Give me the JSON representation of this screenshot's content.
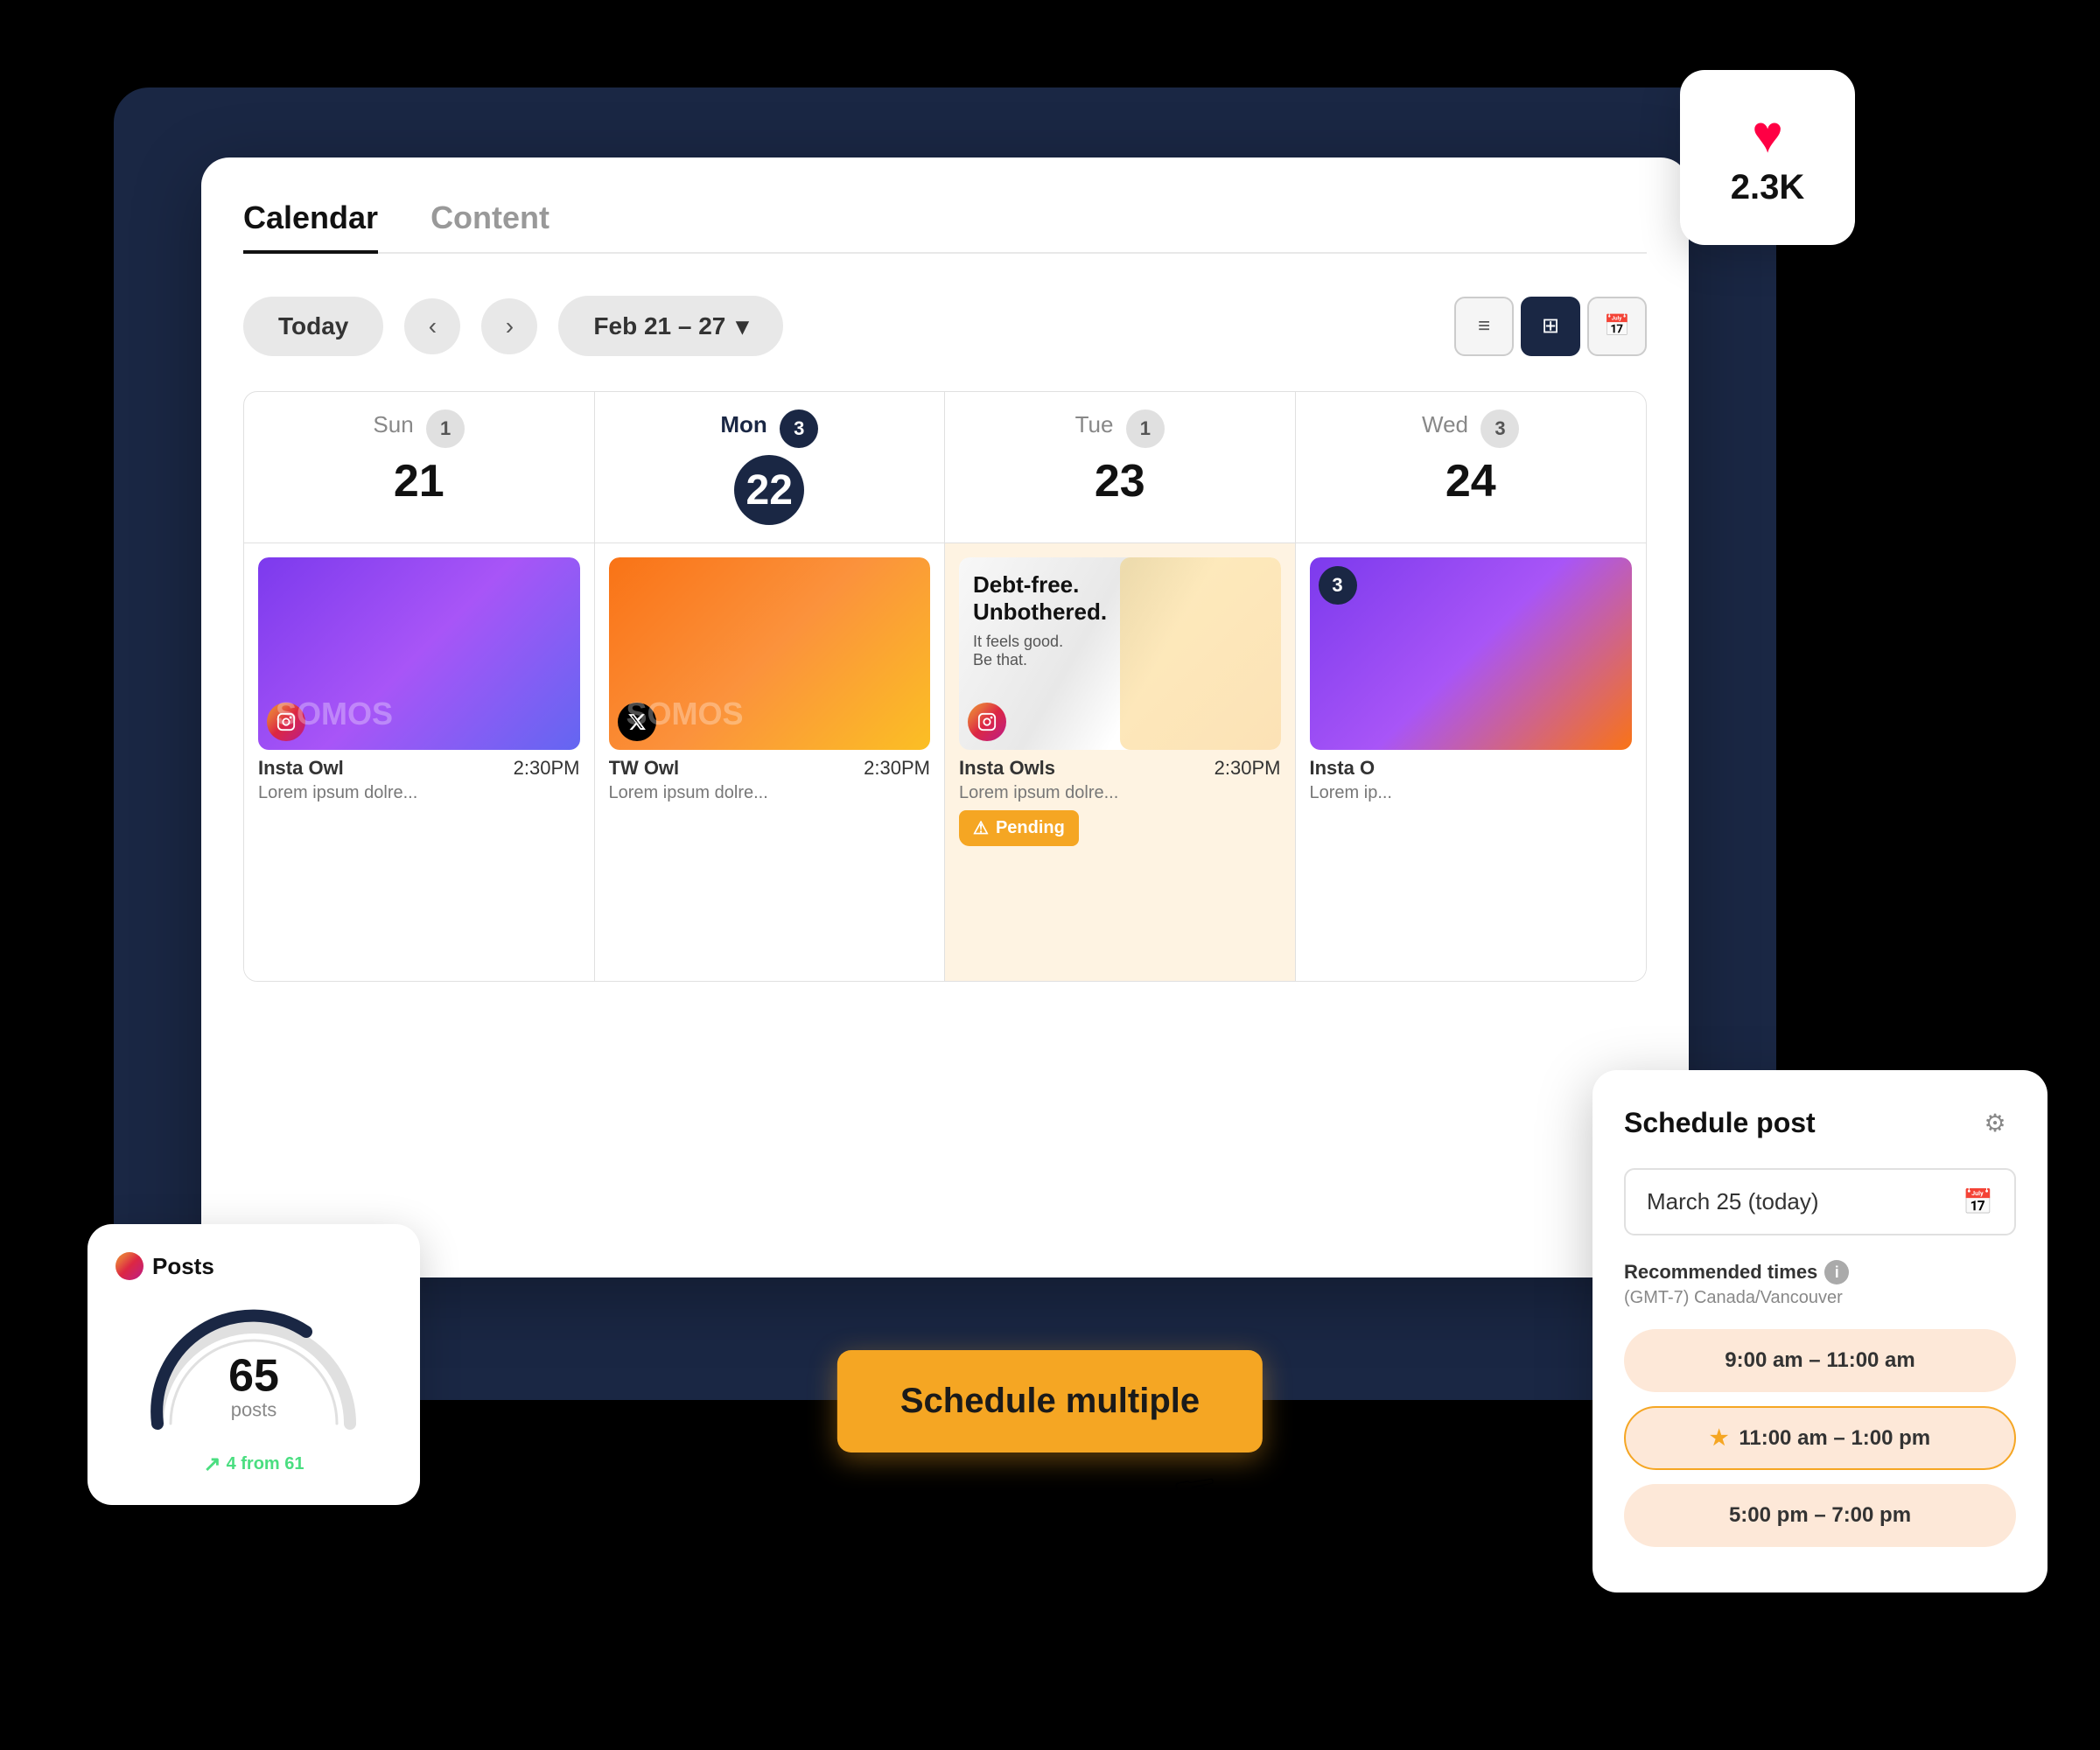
{
  "tabs": [
    {
      "label": "Calendar",
      "active": true
    },
    {
      "label": "Content",
      "active": false
    }
  ],
  "toolbar": {
    "today_label": "Today",
    "date_range": "Feb 21 – 27",
    "chevron": "▾"
  },
  "view_buttons": [
    {
      "icon": "≡",
      "label": "list-view",
      "active": false
    },
    {
      "icon": "⊞",
      "label": "grid-view",
      "active": true
    },
    {
      "icon": "📅",
      "label": "calendar-view",
      "active": false
    }
  ],
  "days": [
    {
      "name": "Sun",
      "number": "21",
      "badge": "1",
      "active": false
    },
    {
      "name": "Mon",
      "number": "22",
      "badge": "3",
      "active": true
    },
    {
      "name": "Tue",
      "number": "23",
      "badge": "1",
      "active": false
    },
    {
      "name": "Wed",
      "number": "24",
      "badge": "3",
      "active": false
    }
  ],
  "posts": {
    "sun": {
      "time": "2:30PM",
      "account": "Insta Owl",
      "text": "Lorem ipsum dolre...",
      "platform": "instagram"
    },
    "mon": {
      "time": "2:30PM",
      "account": "TW Owl",
      "text": "Lorem ipsum dolre...",
      "platform": "twitter"
    },
    "tue": {
      "time": "2:30PM",
      "account": "Insta Owls",
      "text": "Lorem ipsum dolre...",
      "platform": "instagram",
      "status": "Pending"
    },
    "wed": {
      "account": "Insta O",
      "text": "Lorem ip...",
      "num": "3",
      "platform": "instagram"
    }
  },
  "heart_card": {
    "count": "2.3K"
  },
  "posts_widget": {
    "title": "Posts",
    "gauge_number": "65",
    "gauge_label": "posts",
    "sub_label": "4 from 61"
  },
  "schedule_multiple": {
    "label": "Schedule multiple"
  },
  "schedule_panel": {
    "title": "Schedule post",
    "date": "March 25 (today)",
    "recommended_label": "Recommended times",
    "timezone": "(GMT-7) Canada/Vancouver",
    "time_slots": [
      {
        "time": "9:00 am – 11:00 am",
        "selected": false
      },
      {
        "time": "11:00 am – 1:00 pm",
        "selected": true
      },
      {
        "time": "5:00 pm – 7:00 pm",
        "selected": false
      }
    ]
  }
}
